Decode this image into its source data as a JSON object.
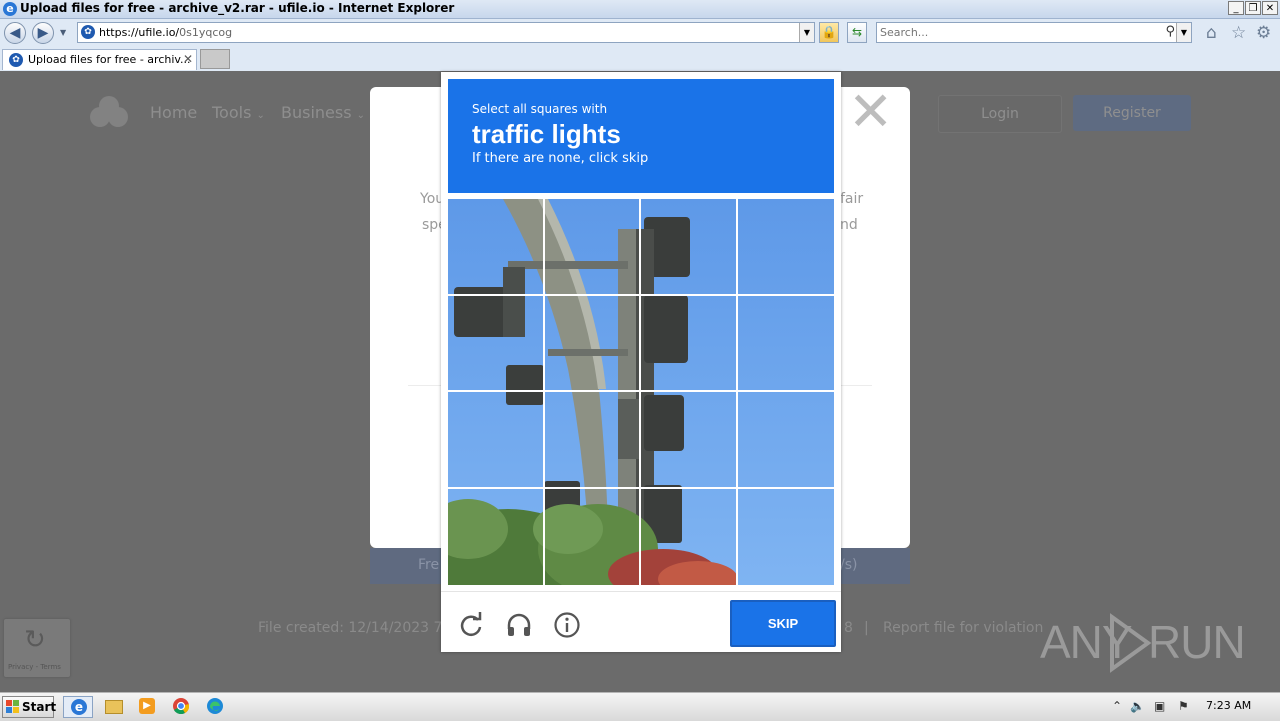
{
  "window": {
    "title": "Upload files for free - archive_v2.rar - ufile.io - Internet Explorer",
    "controls": [
      "minimize",
      "restore",
      "close"
    ]
  },
  "navbar": {
    "url_prefix": "https://ufile.io/",
    "url_path": "0s1yqcog",
    "search_placeholder": "Search..."
  },
  "tabs": [
    {
      "label": "Upload files for free - archiv...",
      "active": true
    }
  ],
  "page": {
    "nav": {
      "home": "Home",
      "tools": "Tools",
      "business": "Business",
      "login": "Login",
      "register": "Register"
    },
    "modal": {
      "close_symbol": "✕",
      "fragment_line1_left": "You",
      "fragment_line2_left": "spe",
      "fragment_line1_right": "fair",
      "fragment_line2_right": "nd"
    },
    "band": {
      "left": "Fre",
      "right": "/s)"
    },
    "footer": {
      "file_created": "File created: 12/14/2023 7:22",
      "mid": "8",
      "divider": "|",
      "report": "Report file for violation"
    },
    "recaptcha_badge": "Privacy - Terms"
  },
  "captcha": {
    "header": {
      "instruction": "Select all squares with",
      "target": "traffic lights",
      "hint": "If there are none, click skip"
    },
    "grid": {
      "rows": 4,
      "cols": 4
    },
    "footer": {
      "refresh_icon": "refresh-icon",
      "audio_icon": "headphones-icon",
      "info_icon": "info-icon",
      "skip_label": "SKIP"
    },
    "colors": {
      "header": "#1a73e8",
      "sky": "#6fa8ee",
      "pole": "#8e9386",
      "light": "#3a3d3b",
      "tree": "#4f7a3a"
    }
  },
  "watermark": {
    "left": "ANY",
    "right": "RUN"
  },
  "taskbar": {
    "start": "Start",
    "apps": [
      "internet-explorer",
      "file-explorer",
      "media-player",
      "chrome",
      "edge"
    ],
    "clock": "7:23 AM"
  }
}
